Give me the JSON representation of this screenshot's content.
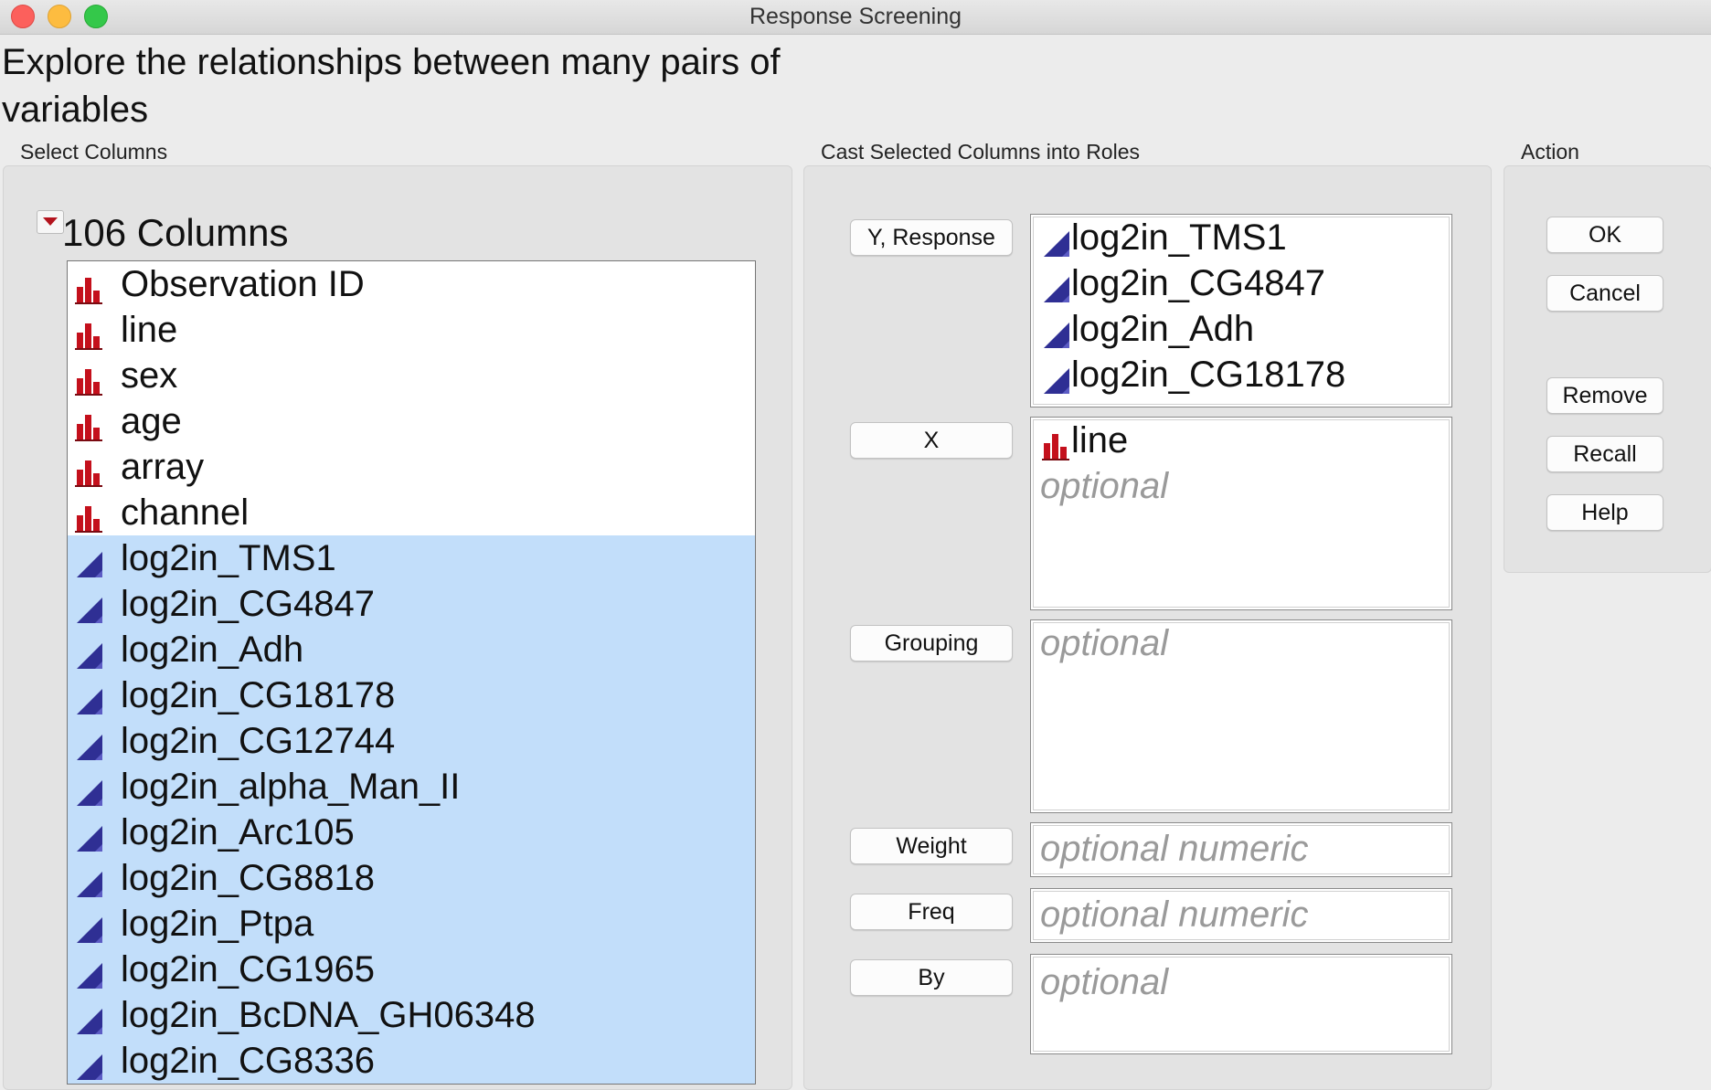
{
  "window": {
    "title": "Response Screening"
  },
  "instruction": "Explore the relationships between many pairs of variables",
  "sections": {
    "select": "Select Columns",
    "cast": "Cast Selected Columns into Roles",
    "action": "Action"
  },
  "columns": {
    "count_label": "106 Columns",
    "items": [
      {
        "name": "Observation ID",
        "type": "nominal",
        "selected": false
      },
      {
        "name": "line",
        "type": "nominal",
        "selected": false
      },
      {
        "name": "sex",
        "type": "nominal",
        "selected": false
      },
      {
        "name": "age",
        "type": "nominal",
        "selected": false
      },
      {
        "name": "array",
        "type": "nominal",
        "selected": false
      },
      {
        "name": "channel",
        "type": "nominal",
        "selected": false
      },
      {
        "name": "log2in_TMS1",
        "type": "continuous",
        "selected": true
      },
      {
        "name": "log2in_CG4847",
        "type": "continuous",
        "selected": true
      },
      {
        "name": "log2in_Adh",
        "type": "continuous",
        "selected": true
      },
      {
        "name": "log2in_CG18178",
        "type": "continuous",
        "selected": true
      },
      {
        "name": "log2in_CG12744",
        "type": "continuous",
        "selected": true
      },
      {
        "name": "log2in_alpha_Man_II",
        "type": "continuous",
        "selected": true
      },
      {
        "name": "log2in_Arc105",
        "type": "continuous",
        "selected": true
      },
      {
        "name": "log2in_CG8818",
        "type": "continuous",
        "selected": true
      },
      {
        "name": "log2in_Ptpa",
        "type": "continuous",
        "selected": true
      },
      {
        "name": "log2in_CG1965",
        "type": "continuous",
        "selected": true
      },
      {
        "name": "log2in_BcDNA_GH06348",
        "type": "continuous",
        "selected": true
      },
      {
        "name": "log2in_CG8336",
        "type": "continuous",
        "selected": true
      }
    ]
  },
  "roles": {
    "y_response": {
      "label": "Y, Response",
      "items": [
        {
          "name": "log2in_TMS1",
          "type": "continuous"
        },
        {
          "name": "log2in_CG4847",
          "type": "continuous"
        },
        {
          "name": "log2in_Adh",
          "type": "continuous"
        },
        {
          "name": "log2in_CG18178",
          "type": "continuous"
        }
      ]
    },
    "x": {
      "label": "X",
      "items": [
        {
          "name": "line",
          "type": "nominal"
        }
      ],
      "placeholder": "optional"
    },
    "grouping": {
      "label": "Grouping",
      "placeholder": "optional"
    },
    "weight": {
      "label": "Weight",
      "placeholder": "optional numeric"
    },
    "freq": {
      "label": "Freq",
      "placeholder": "optional numeric"
    },
    "by": {
      "label": "By",
      "placeholder": "optional"
    }
  },
  "actions": {
    "ok": "OK",
    "cancel": "Cancel",
    "remove": "Remove",
    "recall": "Recall",
    "help": "Help"
  },
  "icons": {
    "nominal": "nominal-bar-chart-icon",
    "continuous": "continuous-triangle-icon"
  },
  "colors": {
    "selection": "#c2defa",
    "nominal_icon": "#c4101c",
    "continuous_icon": "#2f2f94",
    "close": "#fc605c",
    "minimize": "#fdbc40",
    "maximize": "#34c84a"
  }
}
